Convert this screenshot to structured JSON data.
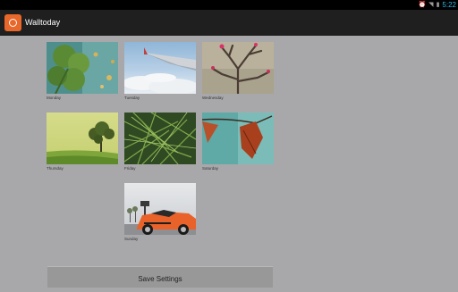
{
  "status": {
    "time": "5:22"
  },
  "app": {
    "title": "Walltoday"
  },
  "days": [
    {
      "label": "Monday",
      "image": "clover-leaf-with-water-drops"
    },
    {
      "label": "Tuesday",
      "image": "airplane-wing-over-clouds"
    },
    {
      "label": "Wednesday",
      "image": "bare-branches-with-pink-buds"
    },
    {
      "label": "Thursday",
      "image": "lone-tree-on-green-field"
    },
    {
      "label": "Friday",
      "image": "grass-close-up"
    },
    {
      "label": "Saturday",
      "image": "autumn-leaves-on-teal"
    },
    {
      "label": "Sunday",
      "image": "orange-muscle-car"
    }
  ],
  "actions": {
    "save_label": "Save Settings"
  },
  "colors": {
    "background": "#a8a8ab",
    "actionbar": "#1f1f1f",
    "accent": "#33b5e5",
    "app_icon": "#e8672a"
  }
}
